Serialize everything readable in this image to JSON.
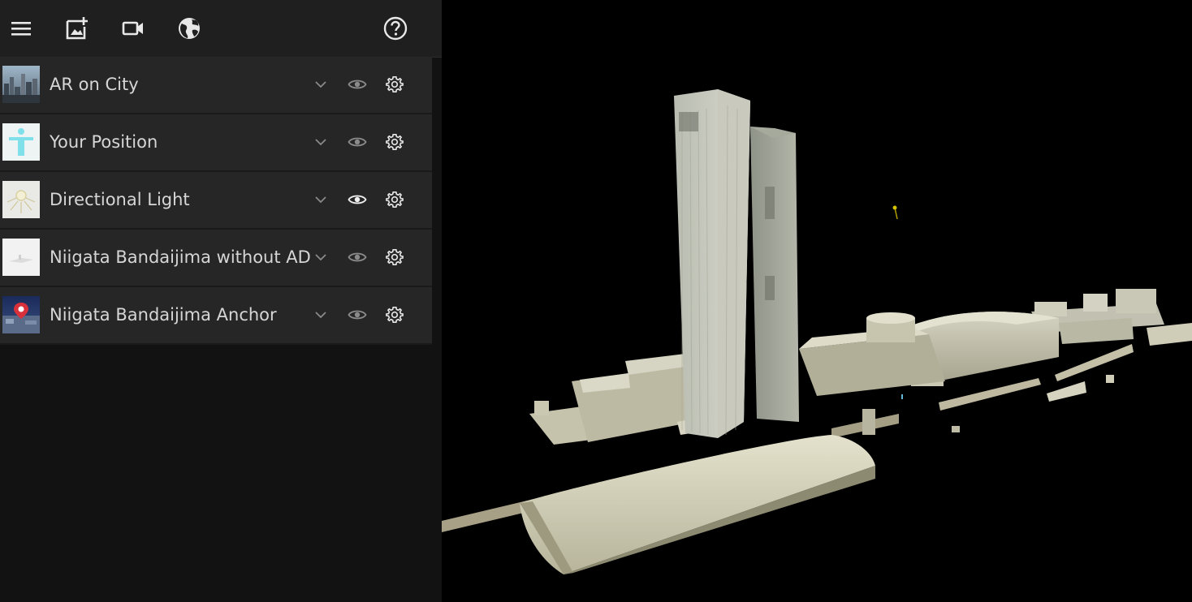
{
  "toolbar": {
    "buttons": [
      {
        "name": "menu-icon"
      },
      {
        "name": "add-image-icon"
      },
      {
        "name": "video-camera-icon"
      },
      {
        "name": "globe-icon"
      },
      {
        "name": "help-icon"
      }
    ]
  },
  "layers": [
    {
      "label": "AR on City",
      "thumbnail": "city-skyline",
      "visible": false
    },
    {
      "label": "Your Position",
      "thumbnail": "person-figure",
      "visible": false
    },
    {
      "label": "Directional Light",
      "thumbnail": "light-bulb",
      "visible": true
    },
    {
      "label": "Niigata Bandaijima without AD",
      "thumbnail": "white-model",
      "visible": false
    },
    {
      "label": "Niigata Bandaijima Anchor",
      "thumbnail": "map-pin",
      "visible": false
    }
  ],
  "colors": {
    "toolbar_bg": "#1f1f1f",
    "panel_bg": "#121212",
    "row_bg": "#262626",
    "text": "#d6d6d6",
    "icon_dim": "#8a8a8a",
    "icon_active": "#f0f0f0",
    "viewport_bg": "#000000"
  }
}
